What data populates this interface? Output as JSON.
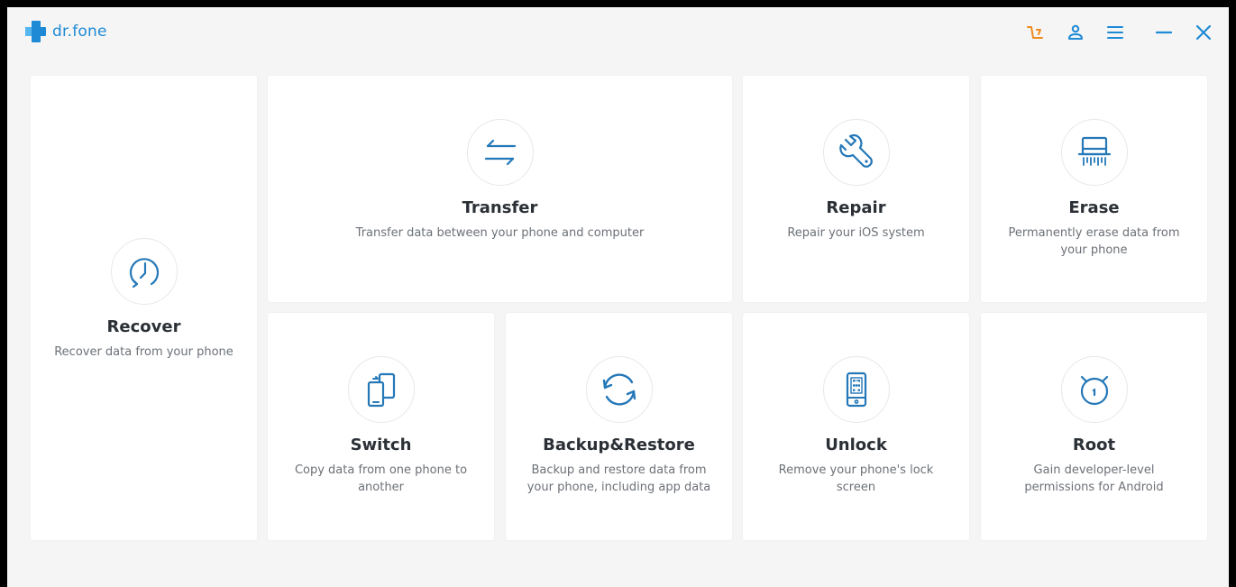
{
  "app": {
    "name": "dr.fone"
  },
  "colors": {
    "brand_blue": "#1e8ad6",
    "cart_orange": "#f08a1c",
    "icon_stroke": "#2478b8",
    "card_bg": "#ffffff",
    "window_bg": "#f5f5f5"
  },
  "titlebar_icons": [
    "cart-icon",
    "user-icon",
    "menu-icon",
    "minimize-icon",
    "close-icon"
  ],
  "modules": {
    "recover": {
      "title": "Recover",
      "desc": "Recover data from your phone",
      "icon": "clock-icon"
    },
    "transfer": {
      "title": "Transfer",
      "desc": "Transfer data between your phone and computer",
      "icon": "transfer-arrows-icon"
    },
    "repair": {
      "title": "Repair",
      "desc": "Repair your iOS system",
      "icon": "wrench-icon"
    },
    "erase": {
      "title": "Erase",
      "desc": "Permanently erase data from your phone",
      "icon": "shredder-icon"
    },
    "switch": {
      "title": "Switch",
      "desc": "Copy data from one phone to another",
      "icon": "phone-switch-icon"
    },
    "backup": {
      "title": "Backup&Restore",
      "desc": "Backup and restore data from your phone, including app data",
      "icon": "sync-icon"
    },
    "unlock": {
      "title": "Unlock",
      "desc": "Remove your phone's lock screen",
      "icon": "phone-lock-icon"
    },
    "root": {
      "title": "Root",
      "desc": "Gain developer-level permissions for Android",
      "icon": "stopwatch-icon"
    }
  }
}
